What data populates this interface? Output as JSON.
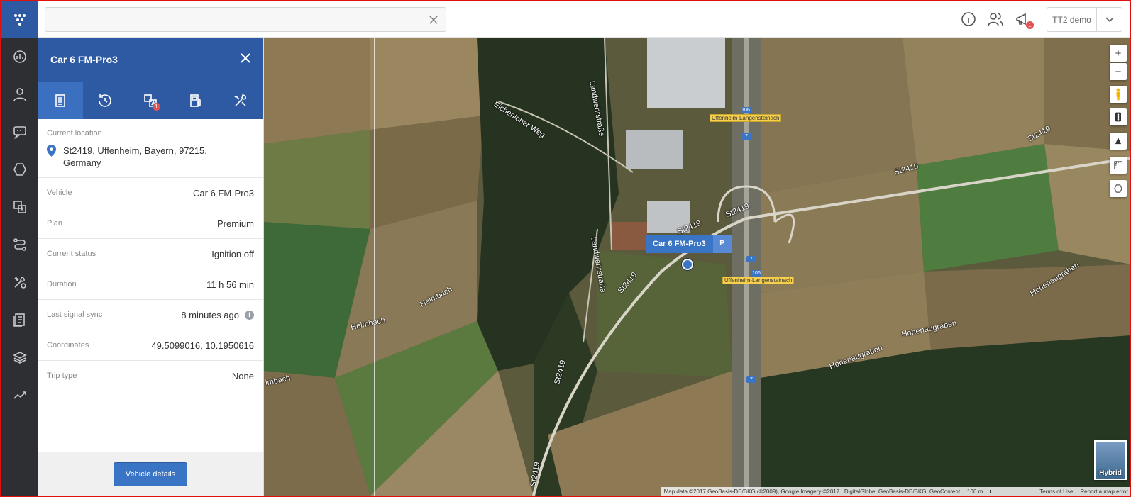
{
  "topbar": {
    "search": {
      "value": "",
      "placeholder": ""
    },
    "account": {
      "name": "TT2 demo"
    },
    "notification_count": "1"
  },
  "rail": {
    "items": [
      "logo-icon",
      "dashboard-icon",
      "user-icon",
      "messages-icon",
      "geofence-icon",
      "reports-icon",
      "routes-icon",
      "maintenance-icon",
      "tasks-icon",
      "layers-icon",
      "analytics-icon"
    ]
  },
  "panel": {
    "title": "Car 6 FM-Pro3",
    "tabs": [
      "details",
      "history",
      "events",
      "fuel",
      "service"
    ],
    "events_badge": "1",
    "location": {
      "label": "Current location",
      "address_line1": "St2419, Uffenheim, Bayern, 97215,",
      "address_line2": "Germany"
    },
    "rows": [
      {
        "key": "Vehicle",
        "value": "Car 6 FM-Pro3"
      },
      {
        "key": "Plan",
        "value": "Premium"
      },
      {
        "key": "Current status",
        "value": "Ignition off"
      },
      {
        "key": "Duration",
        "value": "11 h 56 min"
      },
      {
        "key": "Last signal sync",
        "value": "8 minutes ago"
      },
      {
        "key": "Coordinates",
        "value": "49.5099016, 10.1950616"
      },
      {
        "key": "Trip type",
        "value": "None"
      }
    ],
    "details_button": "Vehicle details"
  },
  "map": {
    "vehicle_label": "Car 6 FM-Pro3",
    "parking_label": "P",
    "road_labels": {
      "landwehrstrasse_top": "Landwehrstraße",
      "eichenloher": "Eichenloher Weg",
      "st2419_a": "St2419",
      "st2419_b": "St2419",
      "st2419_c": "St2419",
      "st2419_d": "St2419",
      "st2419_e": "St2419",
      "st2419_f": "St2419",
      "st2419_g": "St2419",
      "landwehrstrasse_mid": "Landwehrstraße",
      "heimbach_a": "Heimbach",
      "heimbach_b": "Heimbach",
      "heimbach_c": "imbach",
      "hohenaugraben_a": "Hohenaugraben",
      "hohenaugraben_b": "Hohenaugraben",
      "hohenaugraben_c": "Hohenaugraben"
    },
    "highway_label_1": "Uffenheim-Langensteinach",
    "highway_label_2": "Uffenheim-Langensteinach",
    "route_106": "106",
    "route_7": "7",
    "zoom_in": "+",
    "zoom_out": "−",
    "map_type": "Hybrid",
    "attribution": "Map data ©2017 GeoBasis-DE/BKG (©2009), Google Imagery ©2017 , DigitalGlobe, GeoBasis-DE/BKG, GeoContent",
    "scale": "100 m",
    "terms": "Terms of Use",
    "report": "Report a map error"
  }
}
